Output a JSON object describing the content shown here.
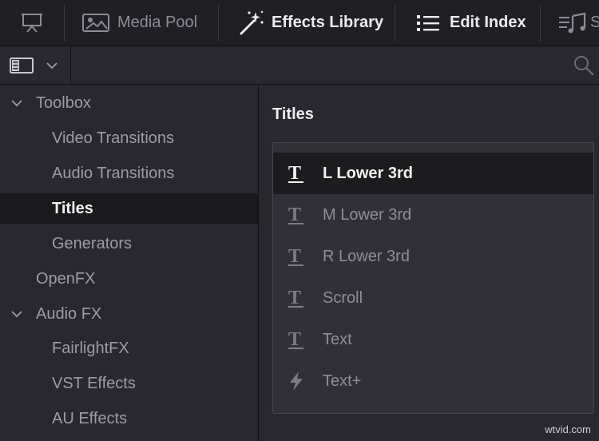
{
  "toolbar": {
    "media_pool": "Media Pool",
    "effects_library": "Effects Library",
    "edit_index": "Edit Index",
    "sound_partial": "S"
  },
  "sidebar": {
    "items": [
      {
        "label": "Toolbox"
      },
      {
        "label": "Video Transitions"
      },
      {
        "label": "Audio Transitions"
      },
      {
        "label": "Titles"
      },
      {
        "label": "Generators"
      },
      {
        "label": "OpenFX"
      },
      {
        "label": "Audio FX"
      },
      {
        "label": "FairlightFX"
      },
      {
        "label": "VST Effects"
      },
      {
        "label": "AU Effects"
      }
    ],
    "selected": "Titles"
  },
  "content": {
    "title": "Titles",
    "items": [
      {
        "label": "L Lower 3rd",
        "icon": "title-t-icon"
      },
      {
        "label": "M Lower 3rd",
        "icon": "title-t-icon"
      },
      {
        "label": "R Lower 3rd",
        "icon": "title-t-icon"
      },
      {
        "label": "Scroll",
        "icon": "title-t-icon"
      },
      {
        "label": "Text",
        "icon": "title-t-icon"
      },
      {
        "label": "Text+",
        "icon": "fusion-bolt-icon"
      }
    ],
    "selected": "L Lower 3rd"
  },
  "watermark": "wtvid.com",
  "colors": {
    "background": "#28282e",
    "toolbar": "#1f1f24",
    "selected_row": "#1a1a1d",
    "text_active": "#f2f2f4",
    "text_dim": "#9c9ca2"
  }
}
